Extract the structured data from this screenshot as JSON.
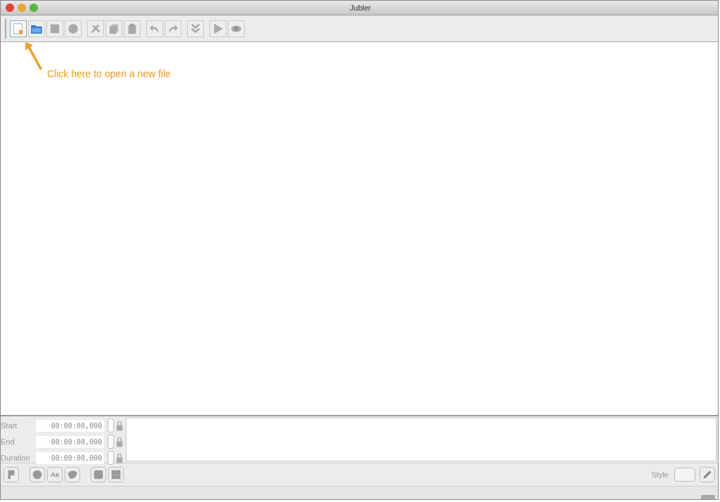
{
  "window": {
    "title": "Jubler"
  },
  "toolbar_groups": [
    {
      "buttons": [
        {
          "kind": "new",
          "disabled": false,
          "selected": true
        },
        {
          "kind": "open",
          "disabled": false,
          "selected": false
        },
        {
          "kind": "save",
          "disabled": true,
          "selected": false
        },
        {
          "kind": "info",
          "disabled": true,
          "selected": false
        }
      ]
    },
    {
      "buttons": [
        {
          "kind": "cut",
          "disabled": true,
          "selected": false
        },
        {
          "kind": "copy",
          "disabled": true,
          "selected": false
        },
        {
          "kind": "paste",
          "disabled": true,
          "selected": false
        }
      ]
    },
    {
      "buttons": [
        {
          "kind": "undo",
          "disabled": true,
          "selected": false
        },
        {
          "kind": "redo",
          "disabled": true,
          "selected": false
        }
      ]
    },
    {
      "buttons": [
        {
          "kind": "join",
          "disabled": true,
          "selected": false
        }
      ]
    },
    {
      "buttons": [
        {
          "kind": "play",
          "disabled": true,
          "selected": false
        },
        {
          "kind": "preview",
          "disabled": true,
          "selected": false
        }
      ]
    }
  ],
  "annotation": {
    "text": "Click here to open a new file"
  },
  "time_fields": [
    {
      "label": "Start",
      "value": "00:00:00,000"
    },
    {
      "label": "End",
      "value": "00:00:00,000"
    },
    {
      "label": "Duration",
      "value": "00:00:00,000"
    }
  ],
  "bottom_tool_groups": [
    {
      "tools": [
        {
          "kind": "mark"
        }
      ]
    },
    {
      "tools": [
        {
          "kind": "circle"
        },
        {
          "kind": "text",
          "label": "Aa"
        },
        {
          "kind": "blob"
        }
      ]
    },
    {
      "tools": [
        {
          "kind": "square"
        },
        {
          "kind": "grid"
        }
      ]
    }
  ],
  "style": {
    "label": "Style"
  }
}
